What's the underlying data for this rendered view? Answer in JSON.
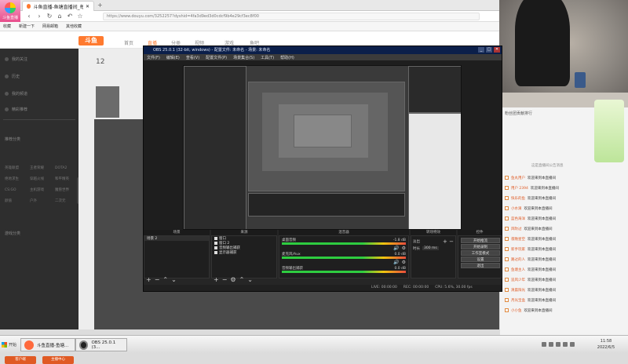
{
  "browser": {
    "logo_caption": "斗鱼直播",
    "tabs": [
      {
        "label": "斗鱼直播-鱼塘直播间_每个人的直播平台"
      },
      {
        "label": "斗鱼直播"
      }
    ],
    "address": "https://www.douyu.com/3252257?dyshid=4fa3d9ed3d0cdcf9b4e29cf3ec8f00",
    "bookmarks": [
      "收藏",
      "新建一下",
      "网易邮箱",
      "其他收藏"
    ]
  },
  "douyu": {
    "site_logo": "斗鱼",
    "nav": [
      "首页",
      "直播",
      "分类",
      "视频",
      "游戏",
      "鱼吧"
    ],
    "room_count": "12",
    "sidebar_sections": [
      "我的关注",
      "历史",
      "我的频道",
      "精彩推荐",
      "推荐分类",
      "游戏分类"
    ],
    "sidebar_grid": [
      "英雄联盟",
      "王者荣耀",
      "DOTA2",
      "绝地求生",
      "穿越火线",
      "和平精英",
      "CS:GO",
      "主机游戏",
      "魔兽世界",
      "颜值",
      "户外",
      "二次元"
    ],
    "sidebar_buttons": [
      "客户端",
      "主播中心"
    ]
  },
  "obs": {
    "title": "OBS 25.0.1 (32-bit, windows) - 配置文件: 未命名 - 场景: 未命名",
    "menu": [
      "文件(F)",
      "编辑(E)",
      "查看(V)",
      "配置文件(P)",
      "场景集合(S)",
      "工具(T)",
      "帮助(H)"
    ],
    "docks": {
      "scenes": {
        "header": "场景",
        "items": [
          "场景 2"
        ]
      },
      "sources": {
        "header": "来源",
        "items": [
          "窗口",
          "窗口 2",
          "音频输出捕获",
          "显示器捕获"
        ]
      },
      "mixer": {
        "header": "混音器",
        "channels": [
          {
            "name": "桌面音频",
            "db": "-1.8 dB"
          },
          {
            "name": "麦克风/Aux",
            "db": "0.0 dB"
          },
          {
            "name": "音频输出捕获",
            "db": "0.0 dB"
          }
        ]
      },
      "transitions": {
        "header": "转场特效",
        "mode": "淡出",
        "duration_label": "时长",
        "duration": "300 ms"
      },
      "controls": {
        "header": "控件",
        "buttons": [
          "开始推流",
          "开始录制",
          "工作室模式",
          "设置",
          "退出"
        ]
      }
    },
    "status": [
      "LIVE: 00:00:00",
      "REC: 00:00:00",
      "CPU: 5.6%, 30.00 fps"
    ]
  },
  "chat": {
    "header": "粉丝团贡献排行",
    "notice": "这是直播间公告消息",
    "messages": [
      {
        "name": "鱼丸用户",
        "text": "欢迎来到本直播间"
      },
      {
        "name": "用户 2394",
        "text": "欢迎来到本直播间"
      },
      {
        "name": "快乐的鱼",
        "text": "欢迎来到本直播间"
      },
      {
        "name": "小水滴",
        "text": "欢迎来到本直播间"
      },
      {
        "name": "蓝色海洋",
        "text": "欢迎来到本直播间"
      },
      {
        "name": "风吹过",
        "text": "欢迎来到本直播间"
      },
      {
        "name": "夜晚星空",
        "text": "欢迎来到本直播间"
      },
      {
        "name": "新手玩家",
        "text": "欢迎来到本直播间"
      },
      {
        "name": "路过的人",
        "text": "欢迎来到本直播间"
      },
      {
        "name": "鱼塘主人",
        "text": "欢迎来到本直播间"
      },
      {
        "name": "追风少年",
        "text": "欢迎来到本直播间"
      },
      {
        "name": "清晨阳光",
        "text": "欢迎来到本直播间"
      },
      {
        "name": "月光宝盒",
        "text": "欢迎来到本直播间"
      },
      {
        "name": "小小鱼",
        "text": "欢迎来到本直播间"
      }
    ]
  },
  "taskbar": {
    "start": "开始",
    "items": [
      {
        "label": "斗鱼直播-鱼塘...",
        "color": "#ff6a3d"
      },
      {
        "label": "OBS 25.0.1 (3...",
        "color": "#222222"
      }
    ],
    "time": "11:58",
    "date": "2022/6/5"
  },
  "colors": {
    "accent": "#ff7a2f",
    "obs_title": "#0b1f4a"
  }
}
